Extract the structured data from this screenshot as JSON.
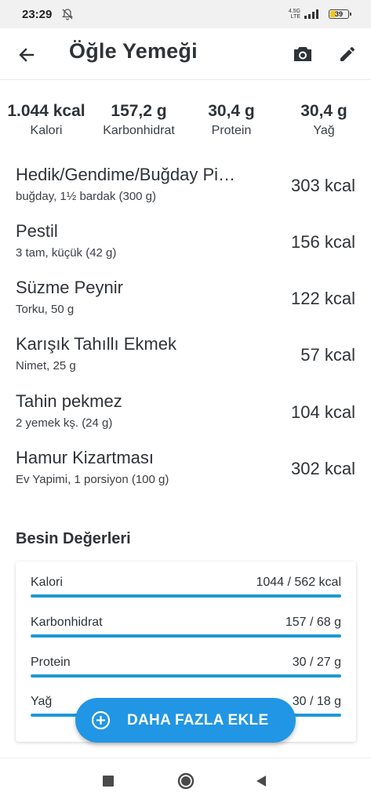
{
  "status_bar": {
    "time": "23:29",
    "network_top": "4.5G",
    "network_bottom": "LTE",
    "battery": "39",
    "battery_level": 0.39
  },
  "app_bar": {
    "title": "Öğle Yemeği"
  },
  "summary": [
    {
      "value": "1.044 kcal",
      "label": "Kalori"
    },
    {
      "value": "157,2 g",
      "label": "Karbonhidrat"
    },
    {
      "value": "30,4 g",
      "label": "Protein"
    },
    {
      "value": "30,4 g",
      "label": "Yağ"
    }
  ],
  "foods": [
    {
      "name": "Hedik/Gendime/Buğday Pi…",
      "portion": "buğday, 1½ bardak (300 g)",
      "kcal": "303 kcal"
    },
    {
      "name": "Pestil",
      "portion": "3 tam, küçük (42 g)",
      "kcal": "156 kcal"
    },
    {
      "name": "Süzme Peynir",
      "portion": "Torku, 50 g",
      "kcal": "122 kcal"
    },
    {
      "name": "Karışık Tahıllı Ekmek",
      "portion": "Nimet, 25 g",
      "kcal": "57 kcal"
    },
    {
      "name": "Tahin pekmez",
      "portion": "2 yemek kş. (24 g)",
      "kcal": "104 kcal"
    },
    {
      "name": "Hamur Kizartması",
      "portion": "Ev Yapimi, 1 porsiyon (100 g)",
      "kcal": "302 kcal"
    }
  ],
  "nutrition": {
    "title": "Besin Değerleri",
    "rows": [
      {
        "label": "Kalori",
        "value": "1044 / 562 kcal",
        "progress": 1.0
      },
      {
        "label": "Karbonhidrat",
        "value": "157 / 68 g",
        "progress": 1.0
      },
      {
        "label": "Protein",
        "value": "30 / 27 g",
        "progress": 1.0
      },
      {
        "label": "Yağ",
        "value": "30 / 18 g",
        "progress": 1.0
      }
    ]
  },
  "fab": {
    "label": "DAHA FAZLA EKLE"
  },
  "colors": {
    "accent": "#2196e4",
    "bar": "#1e98d7",
    "bar_track": "#cfe9f7",
    "text": "#2e3338",
    "battery": "#f5c518"
  },
  "icons": {
    "back": "arrow-left-icon",
    "camera": "camera-icon",
    "edit": "pencil-icon",
    "fab": "plus-circle-icon",
    "mute": "bell-off-icon"
  }
}
